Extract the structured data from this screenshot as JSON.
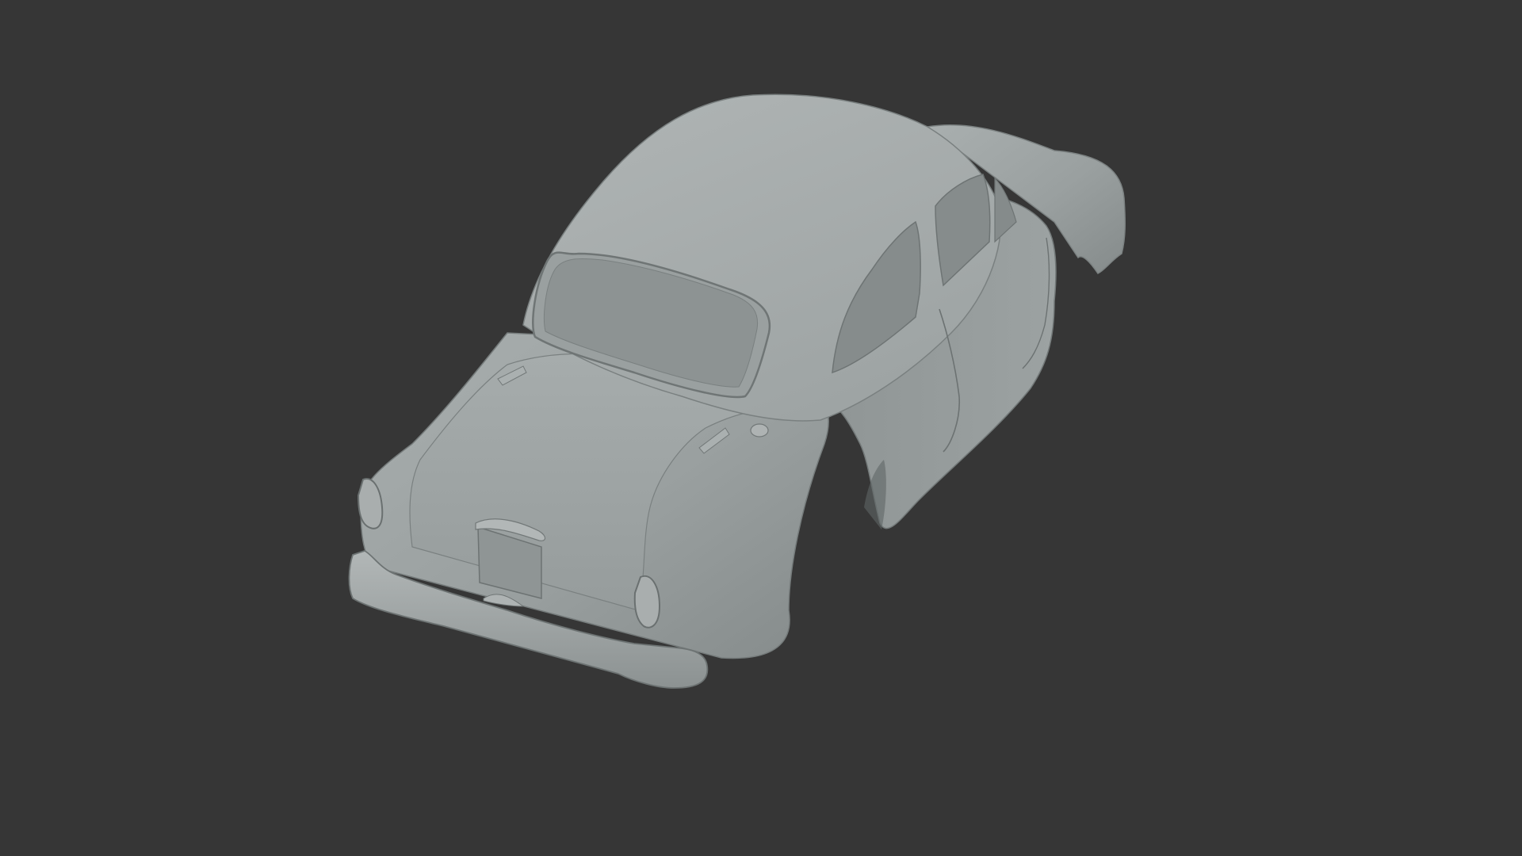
{
  "scene": {
    "background_color": "#363636",
    "subject": "car-body-shell",
    "material_color": "#9ba1a1",
    "material_shadow_color": "#6f7575",
    "material_highlight_color": "#b3b8b8",
    "glass_color": "#8a9090"
  }
}
